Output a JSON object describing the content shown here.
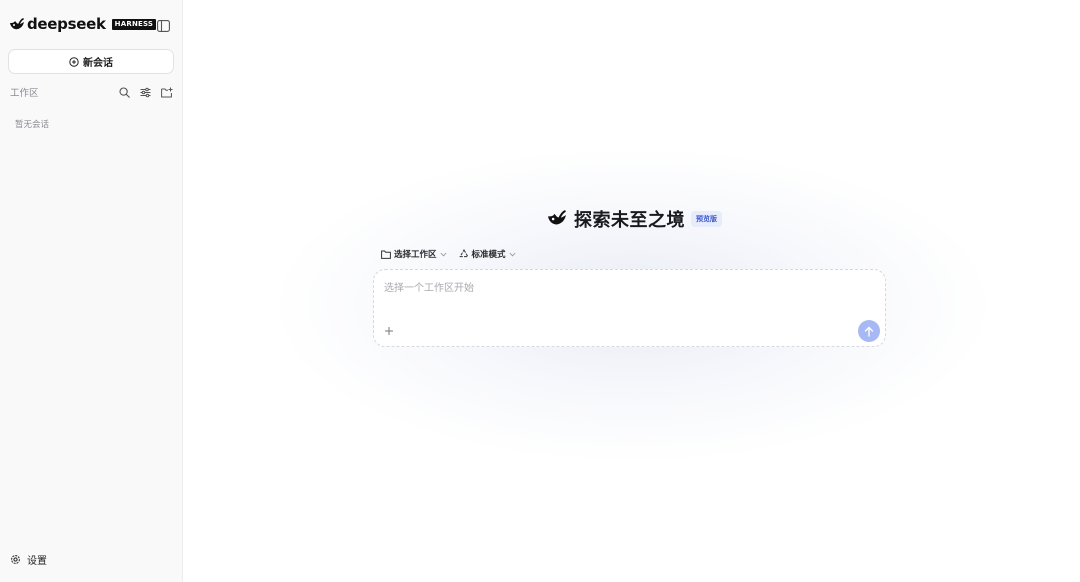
{
  "sidebar": {
    "brand": {
      "name": "deepseek",
      "badge": "HARNESS",
      "logo_icon": "whale-logo-icon"
    },
    "collapse_icon": "sidebar-toggle-icon",
    "new_chat": {
      "label": "新会话",
      "icon": "plus-circle-icon"
    },
    "workspace": {
      "label": "工作区",
      "tools": [
        "search-icon",
        "filter-sliders-icon",
        "new-folder-icon"
      ]
    },
    "empty_text": "暂无会话",
    "settings": {
      "label": "设置",
      "icon": "gear-icon"
    }
  },
  "main": {
    "hero": {
      "title": "探索未至之境",
      "badge": "预览版",
      "logo_icon": "whale-logo-icon"
    },
    "selectors": {
      "workspace": {
        "label": "选择工作区",
        "icon": "folder-icon"
      },
      "mode": {
        "label": "标准模式",
        "icon": "recycle-icon"
      }
    },
    "composer": {
      "placeholder": "选择一个工作区开始",
      "value": "",
      "attach_icon": "plus-icon",
      "send_icon": "arrow-up-icon"
    }
  },
  "colors": {
    "sidebar_bg": "#f9f9fa",
    "accent_badge_bg": "#e7ecfb",
    "accent_badge_text": "#3d5bd1",
    "send_button": "#a7b9f4"
  }
}
